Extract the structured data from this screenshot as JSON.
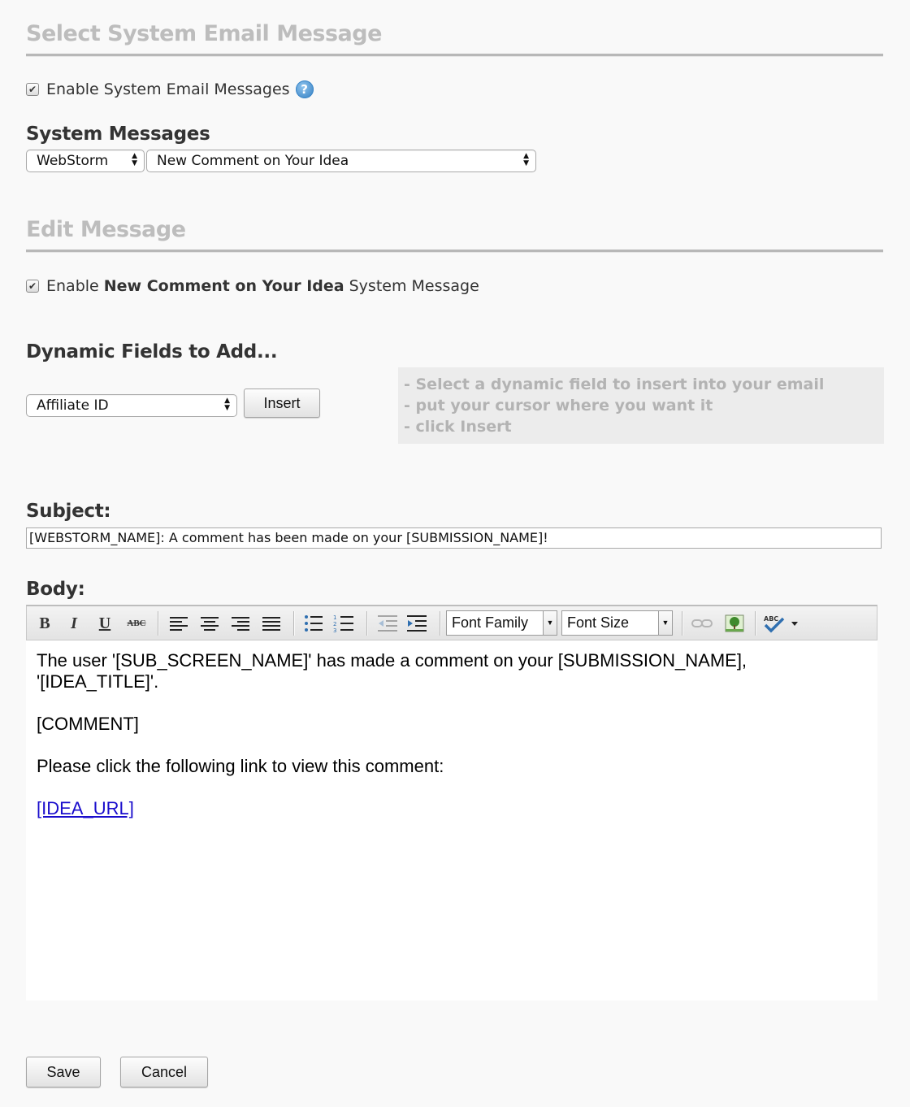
{
  "section_select": {
    "title": "Select System Email Message",
    "enable_label": "Enable System Email Messages",
    "help_icon": "help-question-icon",
    "enable_checked": true
  },
  "system_messages": {
    "heading": "System Messages",
    "webstorm_select": "WebStorm",
    "message_select": "New Comment on Your Idea"
  },
  "section_edit": {
    "title": "Edit Message",
    "enable_prefix": "Enable ",
    "enable_message_name": "New Comment on Your Idea",
    "enable_suffix": " System Message",
    "enable_checked": true
  },
  "dynamic_fields": {
    "heading": "Dynamic Fields to Add...",
    "field_select": "Affiliate ID",
    "insert_label": "Insert",
    "hints": [
      "- Select a dynamic field to insert into your email",
      "- put your cursor where you want it",
      "- click Insert"
    ]
  },
  "subject": {
    "label": "Subject:",
    "value": "[WEBSTORM_NAME]: A comment has been made on your [SUBMISSION_NAME]!"
  },
  "body": {
    "label": "Body:",
    "toolbar": {
      "bold": "B",
      "italic": "I",
      "underline": "U",
      "strikethrough": "ABC",
      "font_family": "Font Family",
      "font_size": "Font Size",
      "icons": [
        "bold-icon",
        "italic-icon",
        "underline-icon",
        "strikethrough-icon",
        "align-left-icon",
        "align-center-icon",
        "align-right-icon",
        "align-justify-icon",
        "bullet-list-icon",
        "numbered-list-icon",
        "outdent-icon",
        "indent-icon",
        "link-icon",
        "image-icon",
        "spellcheck-icon"
      ]
    },
    "paragraph1": "The user '[SUB_SCREEN_NAME]' has made a comment on your [SUBMISSION_NAME], '[IDEA_TITLE]'.",
    "paragraph2": "[COMMENT]",
    "paragraph3": "Please click the following link to view this comment:",
    "link": "[IDEA_URL]"
  },
  "actions": {
    "save_label": "Save",
    "cancel_label": "Cancel"
  },
  "colors": {
    "section_title": "#bdbdbd",
    "hint_box": "#ececec",
    "link": "#1a0dcc"
  }
}
